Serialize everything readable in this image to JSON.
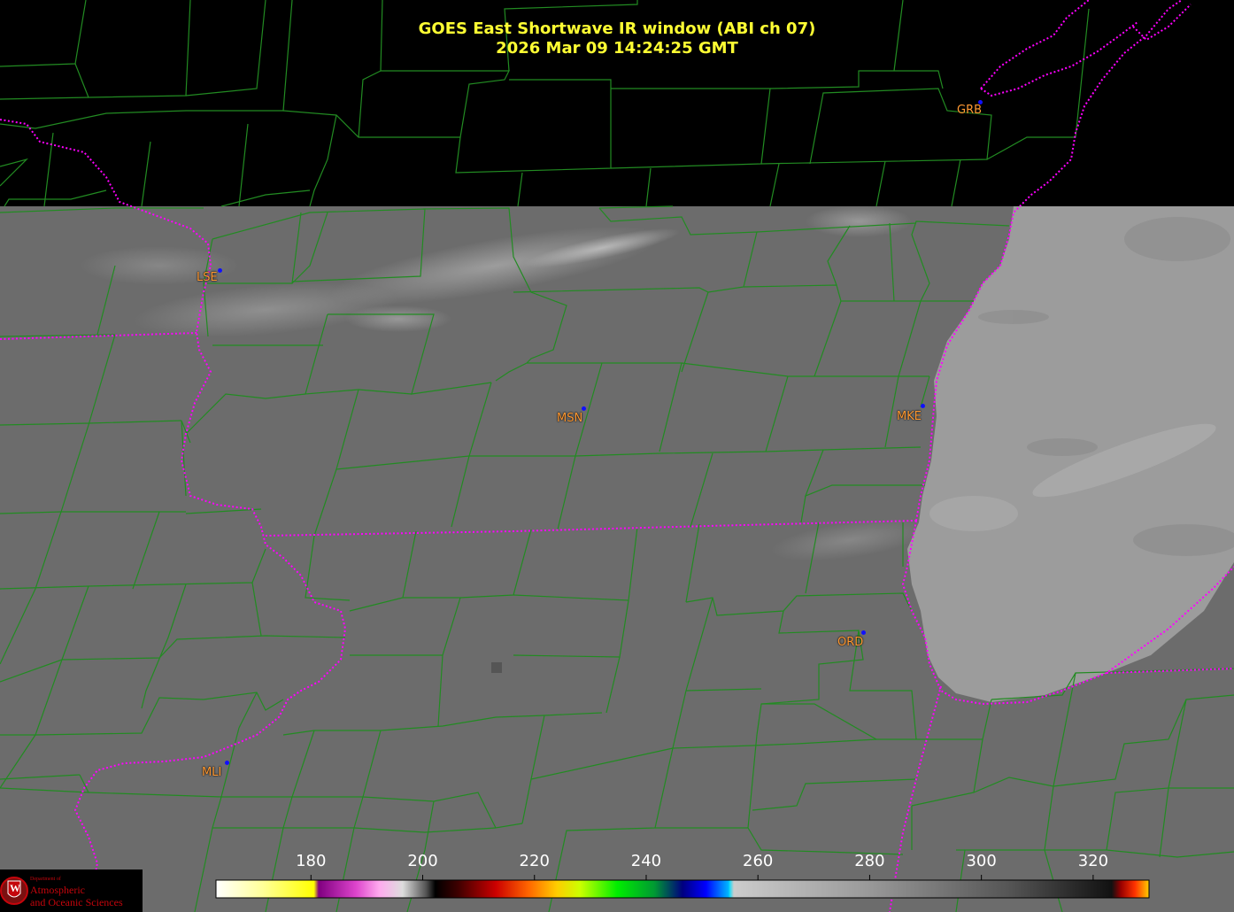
{
  "title": {
    "line1": "GOES East Shortwave IR window (ABI ch 07)",
    "line2": "2026 Mar 09  14:24:25 GMT"
  },
  "stations": [
    {
      "id": "GRB",
      "label": "GRB"
    },
    {
      "id": "LSE",
      "label": "LSE"
    },
    {
      "id": "MSN",
      "label": "MSN"
    },
    {
      "id": "MKE",
      "label": "MKE"
    },
    {
      "id": "ORD",
      "label": "ORD"
    },
    {
      "id": "MLI",
      "label": "MLI"
    }
  ],
  "colorbar": {
    "min": 163,
    "max": 330,
    "ticks": [
      "180",
      "200",
      "220",
      "240",
      "260",
      "280",
      "300",
      "320"
    ]
  },
  "logo": {
    "small": "Department of",
    "line1": "Atmospheric",
    "line2": "and Oceanic Sciences",
    "seal_letter": "W"
  },
  "colors": {
    "title": "#ffff33",
    "county_lines": "#228b22",
    "state_lines": "#ff00ff",
    "station_label": "#ff9933",
    "station_dot": "#1010ff",
    "land": "#6c6c6c",
    "lake": "#9a9a9a",
    "no_data": "#000000"
  }
}
